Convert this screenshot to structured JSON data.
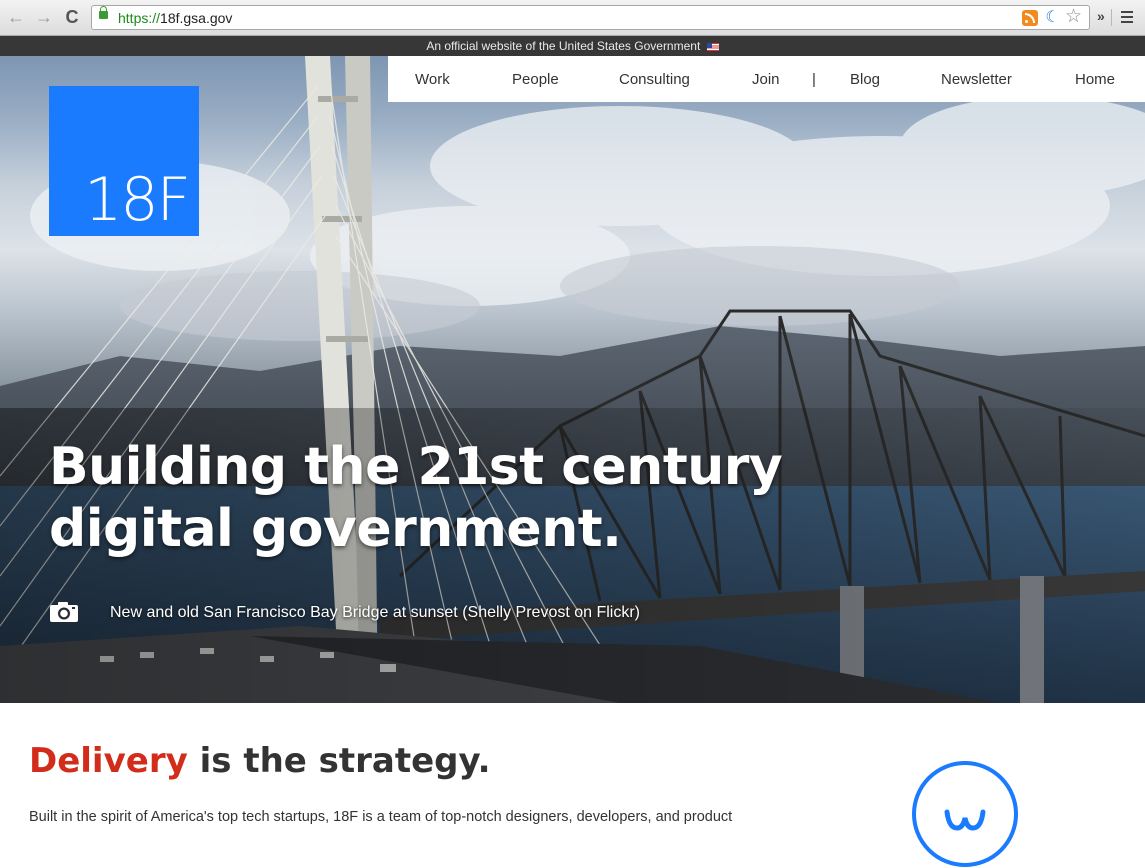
{
  "browser": {
    "url_scheme": "https://",
    "url_host": "18f.gsa.gov",
    "back_glyph": "←",
    "forward_glyph": "→",
    "reload_glyph": "C",
    "star_glyph": "☆",
    "overflow_glyph": "»",
    "moon_glyph": "☾"
  },
  "gov_banner": {
    "text": "An official website of the United States Government"
  },
  "nav": {
    "items": [
      {
        "label": "Work"
      },
      {
        "label": "People"
      },
      {
        "label": "Consulting"
      },
      {
        "label": "Join"
      },
      {
        "label": "|"
      },
      {
        "label": "Blog"
      },
      {
        "label": "Newsletter"
      },
      {
        "label": "Home"
      }
    ]
  },
  "logo": {
    "text": "18F"
  },
  "hero": {
    "headline_line1": "Building the 21st century",
    "headline_line2": "digital government.",
    "caption": "New and old San Francisco Bay Bridge at sunset (Shelly Prevost on Flickr)"
  },
  "content": {
    "heading_accent": "Delivery",
    "heading_rest": " is the strategy.",
    "intro": "Built in the spirit of America's top tech startups, 18F is a team of top-notch designers, developers, and product"
  },
  "colors": {
    "logo_blue": "#1a7bff",
    "accent_red": "#d22c1a",
    "banner_bg": "#373737"
  }
}
